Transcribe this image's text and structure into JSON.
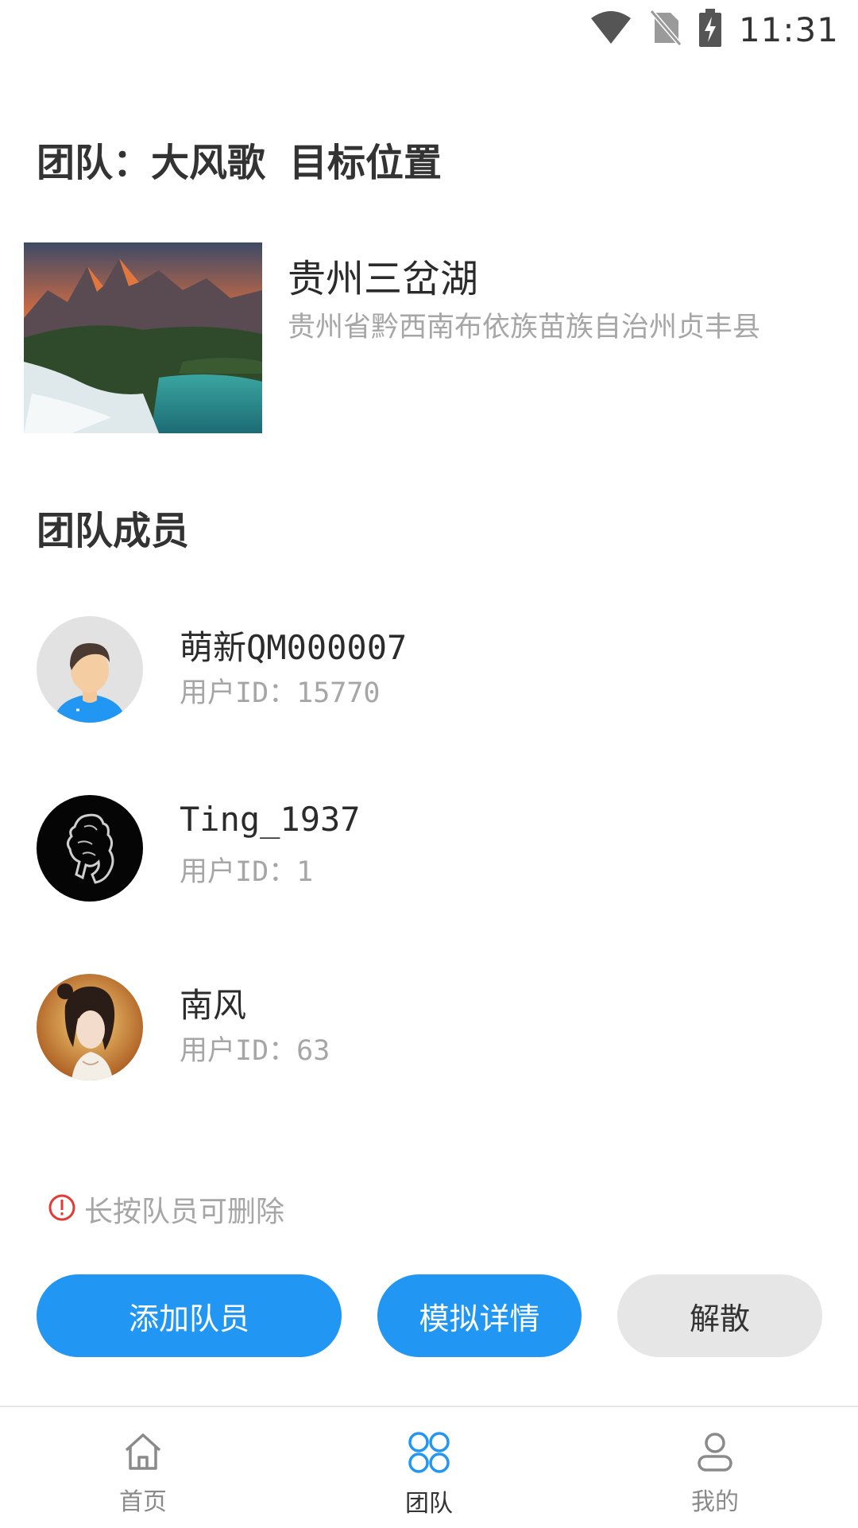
{
  "status_bar": {
    "time": "11:31",
    "icons": [
      "wifi-icon",
      "no-sim-icon",
      "battery-charging-icon"
    ]
  },
  "team": {
    "title_prefix": "团队：大风歌",
    "title_suffix": "目标位置"
  },
  "location": {
    "name": "贵州三岔湖",
    "address": "贵州省黔西南布依族苗族自治州贞丰县"
  },
  "members_section": {
    "title": "团队成员"
  },
  "members": [
    {
      "name": "萌新QM000007",
      "uid": "用户ID：15770"
    },
    {
      "name": "Ting_1937",
      "uid": "用户ID：1"
    },
    {
      "name": "南风",
      "uid": "用户ID：63"
    }
  ],
  "hint": {
    "text": "长按队员可删除",
    "icon": "alert-circle-icon",
    "icon_color": "#e53935"
  },
  "actions": {
    "add_member": "添加队员",
    "simulate_details": "模拟详情",
    "disband": "解散"
  },
  "colors": {
    "accent": "#2196f3",
    "button_gray": "#e6e6e6"
  },
  "tabbar": {
    "items": [
      {
        "label": "首页",
        "icon": "home-icon"
      },
      {
        "label": "团队",
        "icon": "team-icon",
        "active": true
      },
      {
        "label": "我的",
        "icon": "user-icon"
      }
    ]
  }
}
